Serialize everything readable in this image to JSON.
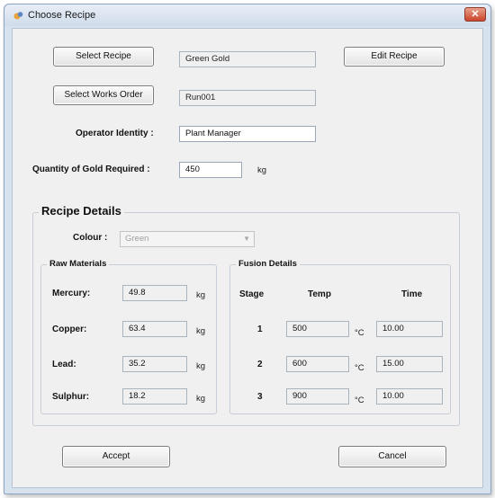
{
  "window": {
    "title": "Choose Recipe",
    "close_symbol": "✕"
  },
  "buttons": {
    "select_recipe": "Select Recipe",
    "edit_recipe": "Edit Recipe",
    "select_works_order": "Select Works Order",
    "accept": "Accept",
    "cancel": "Cancel"
  },
  "fields": {
    "recipe_name": "Green Gold",
    "works_order": "Run001",
    "operator_identity_label": "Operator Identity :",
    "operator_identity": "Plant Manager",
    "quantity_label": "Quantity of Gold Required :",
    "quantity": "450",
    "quantity_unit": "kg"
  },
  "recipe_details": {
    "title": "Recipe Details",
    "colour_label": "Colour :",
    "colour_value": "Green",
    "raw_materials": {
      "title": "Raw Materials",
      "items": [
        {
          "label": "Mercury:",
          "value": "49.8",
          "unit": "kg"
        },
        {
          "label": "Copper:",
          "value": "63.4",
          "unit": "kg"
        },
        {
          "label": "Lead:",
          "value": "35.2",
          "unit": "kg"
        },
        {
          "label": "Sulphur:",
          "value": "18.2",
          "unit": "kg"
        }
      ]
    },
    "fusion_details": {
      "title": "Fusion Details",
      "headers": {
        "stage": "Stage",
        "temp": "Temp",
        "time": "Time"
      },
      "rows": [
        {
          "stage": "1",
          "temp": "500",
          "unit": "°C",
          "time": "10.00"
        },
        {
          "stage": "2",
          "temp": "600",
          "unit": "°C",
          "time": "15.00"
        },
        {
          "stage": "3",
          "temp": "900",
          "unit": "°C",
          "time": "10.00"
        }
      ]
    }
  },
  "colors": {
    "title_bar": "#d0dceb",
    "client_bg": "#f0f0f0",
    "close_button": "#c9452b"
  }
}
